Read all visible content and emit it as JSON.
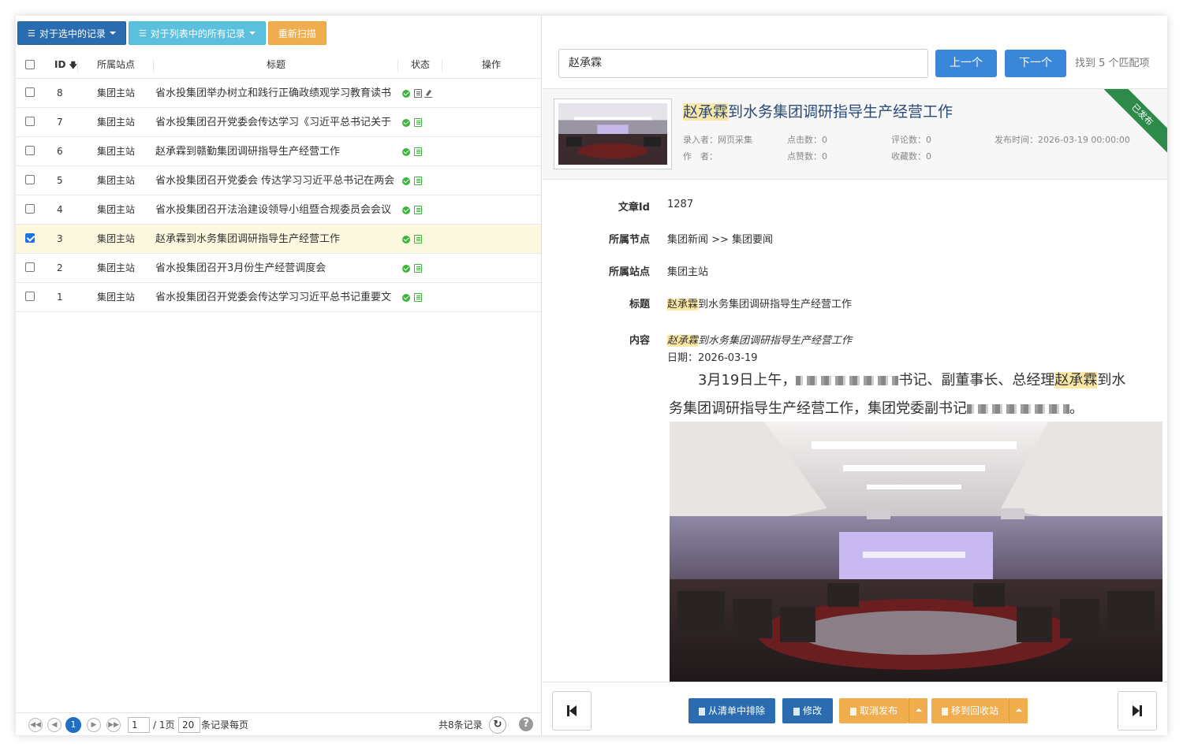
{
  "toolbar": {
    "selected_label": "对于选中的记录",
    "all_label": "对于列表中的所有记录",
    "rescan_label": "重新扫描"
  },
  "table": {
    "headers": {
      "id": "ID",
      "site": "所属站点",
      "title": "标题",
      "status": "状态",
      "action": "操作"
    },
    "rows": [
      {
        "id": "8",
        "site": "集团主站",
        "title": "省水投集团举办树立和践行正确政绩观学习教育读书",
        "checked": false,
        "icon": "doc-grey"
      },
      {
        "id": "7",
        "site": "集团主站",
        "title": "省水投集团召开党委会传达学习《习近平总书记关于",
        "checked": false,
        "icon": "doc-green"
      },
      {
        "id": "6",
        "site": "集团主站",
        "title": "赵承霖到赣勤集团调研指导生产经营工作",
        "checked": false,
        "icon": "doc-green"
      },
      {
        "id": "5",
        "site": "集团主站",
        "title": "省水投集团召开党委会 传达学习习近平总书记在两会",
        "checked": false,
        "icon": "doc-green"
      },
      {
        "id": "4",
        "site": "集团主站",
        "title": "省水投集团召开法治建设领导小组暨合规委员会会议",
        "checked": false,
        "icon": "doc-green"
      },
      {
        "id": "3",
        "site": "集团主站",
        "title": "赵承霖到水务集团调研指导生产经营工作",
        "checked": true,
        "icon": "doc-green"
      },
      {
        "id": "2",
        "site": "集团主站",
        "title": "省水投集团召开3月份生产经营调度会",
        "checked": false,
        "icon": "doc-green"
      },
      {
        "id": "1",
        "site": "集团主站",
        "title": "省水投集团召开党委会传达学习习近平总书记重要文",
        "checked": false,
        "icon": "doc-green"
      }
    ]
  },
  "pager": {
    "current_page": "1",
    "page_input": "1",
    "total_pages_text": "/ 1页",
    "page_size": "20",
    "per_page_text": "条记录每页",
    "total_text": "共8条记录"
  },
  "search": {
    "value": "赵承霖",
    "prev_label": "上一个",
    "next_label": "下一个",
    "found_text": "找到 5 个匹配项"
  },
  "article": {
    "title_highlight": "赵承霖",
    "title_rest": "到水务集团调研指导生产经营工作",
    "ribbon": "已发布",
    "meta": {
      "author_label": "录入者：",
      "author_value": "网页采集",
      "writer_label": "作　者：",
      "clicks_label": "点击数：",
      "clicks_value": "0",
      "likes_label": "点赞数：",
      "likes_value": "0",
      "comments_label": "评论数：",
      "comments_value": "0",
      "favorites_label": "收藏数：",
      "favorites_value": "0",
      "publish_label": "发布时间：",
      "publish_value": "2026-03-19 00:00:00"
    },
    "fields": {
      "id_label": "文章Id",
      "id_value": "1287",
      "node_label": "所属节点",
      "node_value": "集团新闻 >> 集团要闻",
      "site_label": "所属站点",
      "site_value": "集团主站",
      "title_label": "标题",
      "title_hl": "赵承霖",
      "title_rest": "到水务集团调研指导生产经营工作",
      "content_label": "内容",
      "content_hl": "赵承霖",
      "content_rest": "到水务集团调研指导生产经营工作",
      "date_line": "日期：2026-03-19",
      "para1_a": "3月19日上午，",
      "para1_b": "书记、副董事长、总经理",
      "para1_hl": "赵承霖",
      "para1_c": "到水",
      "para2_a": "务集团调研指导生产经营工作，集团党委副书记",
      "para2_end": "。"
    }
  },
  "actions": {
    "remove_label": "从清单中排除",
    "edit_label": "修改",
    "unpublish_label": "取消发布",
    "recycle_label": "移到回收站"
  },
  "colors": {
    "primary": "#2b6cb0",
    "info": "#5bc0de",
    "warning": "#f0ad4e",
    "success": "#3cb43c",
    "highlight": "#fce8a6",
    "ribbon": "#2e8a4a"
  }
}
